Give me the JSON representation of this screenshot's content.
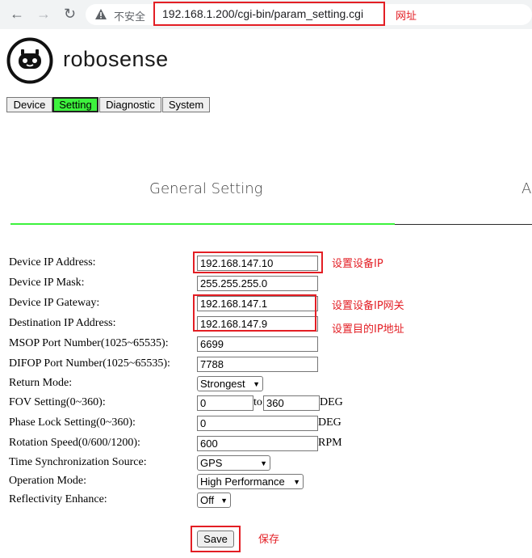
{
  "browser": {
    "back_icon": "arrow-left-icon",
    "forward_icon": "arrow-right-icon",
    "reload_icon": "reload-icon",
    "security_icon": "warning-triangle-icon",
    "security_text": "不安全",
    "url": "192.168.1.200/cgi-bin/param_setting.cgi"
  },
  "annotations": {
    "url": "网址",
    "device_ip": "设置设备IP",
    "gateway": "设置设备IP网关",
    "destination": "设置目的IP地址",
    "save": "保存"
  },
  "logo": {
    "text": "robosense",
    "icon": "robot-head-icon"
  },
  "tabs": [
    {
      "label": "Device"
    },
    {
      "label": "Setting",
      "active": true
    },
    {
      "label": "Diagnostic"
    },
    {
      "label": "System"
    }
  ],
  "section": {
    "title": "General Setting",
    "next_title_partial": "A"
  },
  "colors": {
    "accent": "#3df23d",
    "annotation": "#e31e24"
  },
  "form": {
    "device_ip": {
      "label": "Device IP Address:",
      "value": "192.168.147.10"
    },
    "mask": {
      "label": "Device IP Mask:",
      "value": "255.255.255.0"
    },
    "gateway": {
      "label": "Device IP Gateway:",
      "value": "192.168.147.1"
    },
    "destination": {
      "label": "Destination IP Address:",
      "value": "192.168.147.9"
    },
    "msop": {
      "label": "MSOP Port Number(1025~65535):",
      "value": "6699"
    },
    "difop": {
      "label": "DIFOP Port Number(1025~65535):",
      "value": "7788"
    },
    "return_mode": {
      "label": "Return Mode:",
      "value": "Strongest"
    },
    "fov": {
      "label": "FOV Setting(0~360):",
      "from": "0",
      "to_label": "to",
      "to": "360",
      "unit": "DEG"
    },
    "phase_lock": {
      "label": "Phase Lock Setting(0~360):",
      "value": "0",
      "unit": "DEG"
    },
    "rotation": {
      "label": "Rotation Speed(0/600/1200):",
      "value": "600",
      "unit": "RPM"
    },
    "time_sync": {
      "label": "Time Synchronization Source:",
      "value": "GPS"
    },
    "operation": {
      "label": "Operation Mode:",
      "value": "High Performance"
    },
    "reflectivity": {
      "label": "Reflectivity Enhance:",
      "value": "Off"
    },
    "save_label": "Save"
  }
}
